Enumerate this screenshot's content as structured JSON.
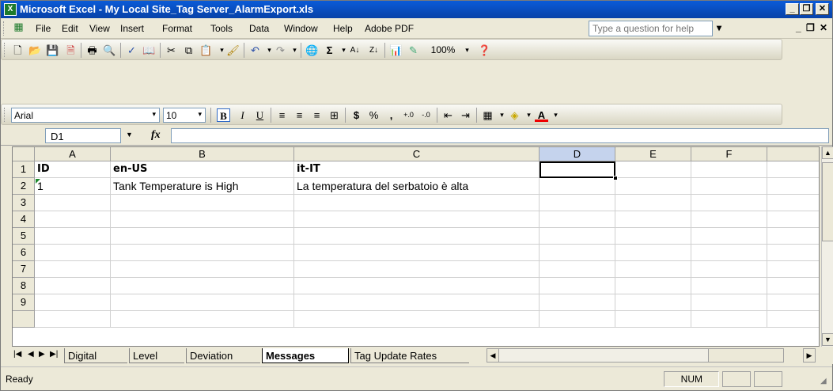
{
  "window": {
    "title": "Microsoft Excel - My Local Site_Tag Server_AlarmExport.xls"
  },
  "menu": {
    "items": [
      "File",
      "Edit",
      "View",
      "Insert",
      "Format",
      "Tools",
      "Data",
      "Window",
      "Help",
      "Adobe PDF"
    ],
    "question_placeholder": "Type a question for help"
  },
  "standard_toolbar": {
    "zoom": "100%"
  },
  "formatting_toolbar": {
    "font": "Arial",
    "size": "10",
    "bold_label": "B",
    "italic_label": "I",
    "underline_label": "U"
  },
  "formula_bar": {
    "name_box": "D1",
    "fx": "fx",
    "value": ""
  },
  "sheet": {
    "columns": [
      "A",
      "B",
      "C",
      "D",
      "E",
      "F"
    ],
    "rows": [
      "1",
      "2",
      "3",
      "4",
      "5",
      "6",
      "7",
      "8",
      "9"
    ],
    "cells": {
      "A1": "ID",
      "B1": "en-US",
      "C1": "it-IT",
      "A2": "1",
      "B2": "Tank Temperature is High",
      "C2": "La temperatura del serbatoio è alta"
    },
    "selected_cell": "D1"
  },
  "sheet_tabs": [
    "Digital",
    "Level",
    "Deviation",
    "Messages",
    "Tag Update Rates"
  ],
  "active_tab": "Messages",
  "status": {
    "left": "Ready",
    "num": "NUM"
  },
  "colors": {
    "title_bar": "#0a5bd8",
    "excel_green": "#1d7a2c",
    "selection": "#000000"
  }
}
